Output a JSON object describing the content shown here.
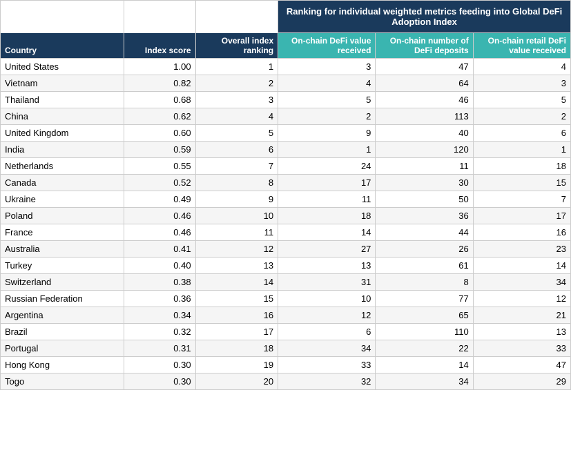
{
  "header": {
    "ranking_title": "Ranking for individual weighted metrics feeding into Global DeFi Adoption Index",
    "col_country": "Country",
    "col_index": "Index score",
    "col_overall": "Overall index ranking",
    "col_onchain_defi": "On-chain DeFi value received",
    "col_onchain_number": "On-chain number of DeFi deposits",
    "col_onchain_retail": "On-chain retail DeFi value received"
  },
  "rows": [
    {
      "country": "United States",
      "index": "1.00",
      "overall": 1,
      "onchain_defi": 3,
      "onchain_number": 47,
      "onchain_retail": 4
    },
    {
      "country": "Vietnam",
      "index": "0.82",
      "overall": 2,
      "onchain_defi": 4,
      "onchain_number": 64,
      "onchain_retail": 3
    },
    {
      "country": "Thailand",
      "index": "0.68",
      "overall": 3,
      "onchain_defi": 5,
      "onchain_number": 46,
      "onchain_retail": 5
    },
    {
      "country": "China",
      "index": "0.62",
      "overall": 4,
      "onchain_defi": 2,
      "onchain_number": 113,
      "onchain_retail": 2
    },
    {
      "country": "United Kingdom",
      "index": "0.60",
      "overall": 5,
      "onchain_defi": 9,
      "onchain_number": 40,
      "onchain_retail": 6
    },
    {
      "country": "India",
      "index": "0.59",
      "overall": 6,
      "onchain_defi": 1,
      "onchain_number": 120,
      "onchain_retail": 1
    },
    {
      "country": "Netherlands",
      "index": "0.55",
      "overall": 7,
      "onchain_defi": 24,
      "onchain_number": 11,
      "onchain_retail": 18
    },
    {
      "country": "Canada",
      "index": "0.52",
      "overall": 8,
      "onchain_defi": 17,
      "onchain_number": 30,
      "onchain_retail": 15
    },
    {
      "country": "Ukraine",
      "index": "0.49",
      "overall": 9,
      "onchain_defi": 11,
      "onchain_number": 50,
      "onchain_retail": 7
    },
    {
      "country": "Poland",
      "index": "0.46",
      "overall": 10,
      "onchain_defi": 18,
      "onchain_number": 36,
      "onchain_retail": 17
    },
    {
      "country": "France",
      "index": "0.46",
      "overall": 11,
      "onchain_defi": 14,
      "onchain_number": 44,
      "onchain_retail": 16
    },
    {
      "country": "Australia",
      "index": "0.41",
      "overall": 12,
      "onchain_defi": 27,
      "onchain_number": 26,
      "onchain_retail": 23
    },
    {
      "country": "Turkey",
      "index": "0.40",
      "overall": 13,
      "onchain_defi": 13,
      "onchain_number": 61,
      "onchain_retail": 14
    },
    {
      "country": "Switzerland",
      "index": "0.38",
      "overall": 14,
      "onchain_defi": 31,
      "onchain_number": 8,
      "onchain_retail": 34
    },
    {
      "country": "Russian Federation",
      "index": "0.36",
      "overall": 15,
      "onchain_defi": 10,
      "onchain_number": 77,
      "onchain_retail": 12
    },
    {
      "country": "Argentina",
      "index": "0.34",
      "overall": 16,
      "onchain_defi": 12,
      "onchain_number": 65,
      "onchain_retail": 21
    },
    {
      "country": "Brazil",
      "index": "0.32",
      "overall": 17,
      "onchain_defi": 6,
      "onchain_number": 110,
      "onchain_retail": 13
    },
    {
      "country": "Portugal",
      "index": "0.31",
      "overall": 18,
      "onchain_defi": 34,
      "onchain_number": 22,
      "onchain_retail": 33
    },
    {
      "country": "Hong Kong",
      "index": "0.30",
      "overall": 19,
      "onchain_defi": 33,
      "onchain_number": 14,
      "onchain_retail": 47
    },
    {
      "country": "Togo",
      "index": "0.30",
      "overall": 20,
      "onchain_defi": 32,
      "onchain_number": 34,
      "onchain_retail": 29
    }
  ]
}
